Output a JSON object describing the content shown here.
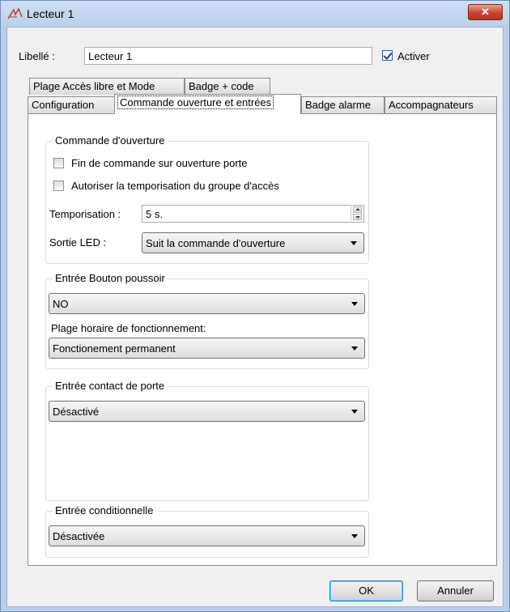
{
  "window": {
    "title": "Lecteur 1",
    "close_label": "✕"
  },
  "header": {
    "libelle_label": "Libellé :",
    "libelle_value": "Lecteur 1",
    "activer_label": "Activer",
    "activer_checked": true
  },
  "tabs_row1": [
    {
      "label": "Plage Accès libre et Mode"
    },
    {
      "label": "Badge + code"
    }
  ],
  "tabs_row2": [
    {
      "label": "Configuration"
    },
    {
      "label": "Commande ouverture et entrées",
      "active": true
    },
    {
      "label": "Badge alarme"
    },
    {
      "label": "Accompagnateurs"
    }
  ],
  "commande": {
    "title": "Commande d'ouverture",
    "fin_commande_label": "Fin de commande sur ouverture porte",
    "fin_commande_checked": false,
    "autoriser_label": "Autoriser la temporisation du groupe d'accès",
    "autoriser_checked": false,
    "temporisation_label": "Temporisation :",
    "temporisation_value": "5 s.",
    "sortie_led_label": "Sortie LED :",
    "sortie_led_value": "Suit la commande d'ouverture"
  },
  "bouton": {
    "title": "Entrée Bouton poussoir",
    "mode_value": "NO",
    "plage_label": "Plage horaire de fonctionnement:",
    "plage_value": "Fonctionement permanent"
  },
  "contact": {
    "title": "Entrée contact de porte",
    "value": "Désactivé"
  },
  "conditionnelle": {
    "title": "Entrée conditionnelle",
    "value": "Désactivée"
  },
  "footer": {
    "ok_label": "OK",
    "cancel_label": "Annuler"
  }
}
